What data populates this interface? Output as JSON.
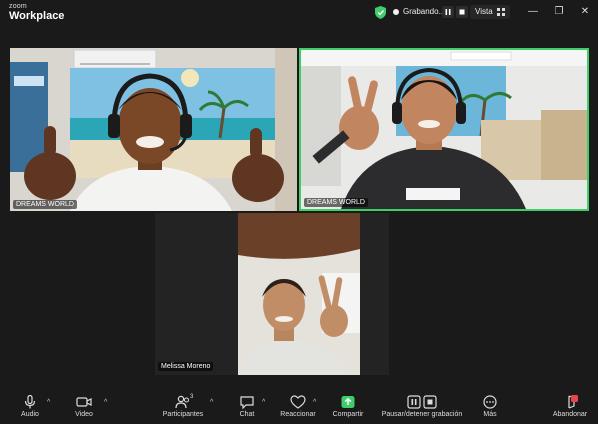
{
  "app": {
    "brand_small": "zoom",
    "brand_big": "Workplace"
  },
  "titlebar": {
    "recording_label": "Grabando...",
    "view_label": "Vista",
    "minimize": "—",
    "restore": "❐",
    "close": "✕"
  },
  "participants": [
    {
      "name": "DREAMS WORLD"
    },
    {
      "name": "DREAMS WORLD"
    },
    {
      "name": "Melissa Moreno"
    }
  ],
  "toolbar": {
    "audio": "Audio",
    "video": "Video",
    "participants": "Participantes",
    "participants_count": "3",
    "chat": "Chat",
    "reactions": "Reaccionar",
    "share": "Compartir",
    "recording": "Pausar/detener grabación",
    "more": "Más",
    "leave": "Abandonar"
  },
  "colors": {
    "active_speaker_border": "#3fcf6a",
    "share_green": "#3fcf6a",
    "leave_red": "#e8444a",
    "shield_green": "#3fcf6a"
  },
  "icons": [
    "shield-icon",
    "record-dot-icon",
    "pause-icon",
    "stop-icon",
    "grid-icon",
    "minimize-icon",
    "restore-icon",
    "close-icon",
    "microphone-icon",
    "camera-icon",
    "participants-icon",
    "chat-icon",
    "reaction-icon",
    "share-icon",
    "recording-control-icon",
    "more-icon",
    "leave-icon"
  ]
}
